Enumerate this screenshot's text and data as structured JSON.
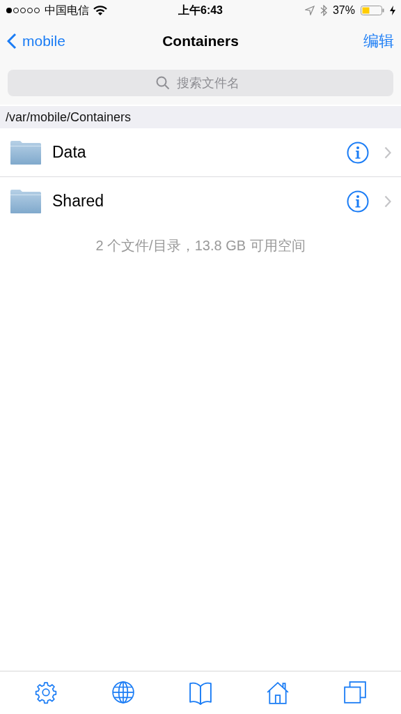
{
  "status_bar": {
    "carrier": "中国电信",
    "time": "上午6:43",
    "battery": "37%"
  },
  "nav": {
    "back": "mobile",
    "title": "Containers",
    "action": "编辑"
  },
  "search": {
    "placeholder": "搜索文件名"
  },
  "path": "/var/mobile/Containers",
  "items": [
    {
      "name": "Data"
    },
    {
      "name": "Shared"
    }
  ],
  "summary": "2 个文件/目录，13.8 GB 可用空间",
  "tab_bar": [
    {
      "kind": "settings"
    },
    {
      "kind": "globe"
    },
    {
      "kind": "book"
    },
    {
      "kind": "home"
    },
    {
      "kind": "windows"
    }
  ]
}
